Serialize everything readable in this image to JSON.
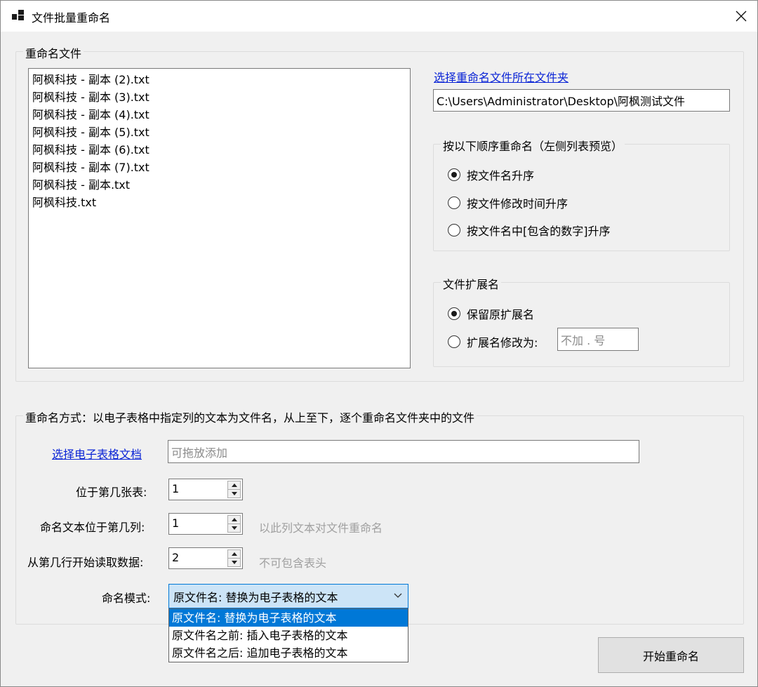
{
  "window": {
    "title": "文件批量重命名",
    "close_glyph": "✕"
  },
  "files_group": {
    "legend": "重命名文件",
    "items": [
      "阿枫科技 - 副本 (2).txt",
      "阿枫科技 - 副本 (3).txt",
      "阿枫科技 - 副本 (4).txt",
      "阿枫科技 - 副本 (5).txt",
      "阿枫科技 - 副本 (6).txt",
      "阿枫科技 - 副本 (7).txt",
      "阿枫科技 - 副本.txt",
      "阿枫科技.txt"
    ],
    "select_folder_link": "选择重命名文件所在文件夹",
    "folder_path": "C:\\Users\\Administrator\\Desktop\\阿枫测试文件"
  },
  "order_group": {
    "legend": "按以下顺序重命名（左侧列表预览）",
    "options": [
      {
        "label": "按文件名升序",
        "checked": true
      },
      {
        "label": "按文件修改时间升序",
        "checked": false
      },
      {
        "label": "按文件名中[包含的数字]升序",
        "checked": false
      }
    ]
  },
  "extension_group": {
    "legend": "文件扩展名",
    "keep_label": "保留原扩展名",
    "keep_checked": true,
    "change_label": "扩展名修改为:",
    "change_checked": false,
    "change_placeholder": "不加 . 号"
  },
  "rename_group": {
    "legend": "重命名方式：以电子表格中指定列的文本为文件名，从上至下，逐个重命名文件夹中的文件",
    "select_sheet_link": "选择电子表格文档",
    "sheet_placeholder": "可拖放添加",
    "sheet_index_label": "位于第几张表:",
    "sheet_index_value": "1",
    "column_label": "命名文本位于第几列:",
    "column_value": "1",
    "column_hint": "以此列文本对文件重命名",
    "start_row_label": "从第几行开始读取数据:",
    "start_row_value": "2",
    "start_row_hint": "不可包含表头",
    "mode_label": "命名模式:",
    "mode_selected": "原文件名: 替换为电子表格的文本",
    "mode_options": [
      "原文件名: 替换为电子表格的文本",
      "原文件名之前: 插入电子表格的文本",
      "原文件名之后: 追加电子表格的文本"
    ]
  },
  "actions": {
    "start_label": "开始重命名"
  }
}
